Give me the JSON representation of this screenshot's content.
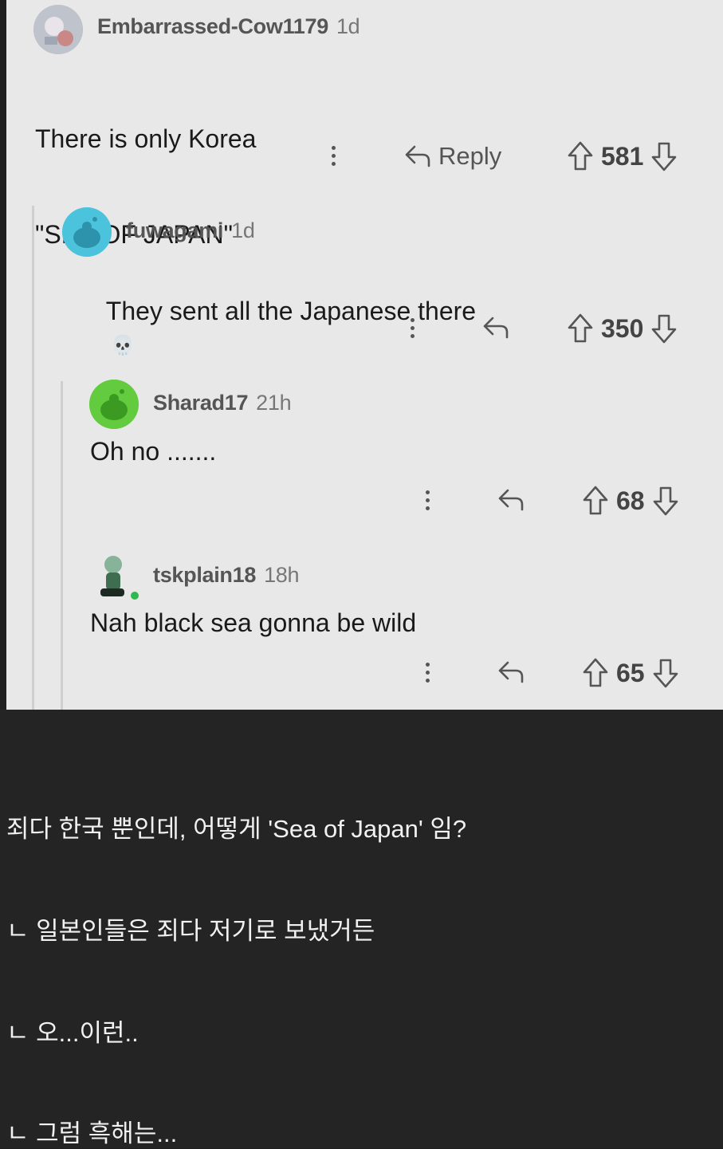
{
  "comments": [
    {
      "user": "Embarrassed-Cow1179",
      "time": "1d",
      "lines": [
        "There is only Korea",
        "\"SEA OF JAPAN\""
      ],
      "reply_label": "Reply",
      "score": "581"
    },
    {
      "user": "fuwagami",
      "time": "1d",
      "text": "They sent all the Japanese there",
      "emoji": "💀",
      "score": "350"
    },
    {
      "user": "Sharad17",
      "time": "21h",
      "text": "Oh no .......",
      "score": "68"
    },
    {
      "user": "tskplain18",
      "time": "18h",
      "text": "Nah black sea gonna be wild",
      "score": "65"
    }
  ],
  "translation": [
    "죄다 한국 뿐인데, 어떻게 'Sea of Japan' 임?",
    "ㄴ 일본인들은 죄다 저기로 보냈거든",
    "ㄴ 오...이런..",
    "ㄴ 그럼 흑해는..."
  ],
  "icons": [
    "more-icon",
    "reply-icon",
    "upvote-icon",
    "downvote-icon",
    "skull-emoji"
  ]
}
